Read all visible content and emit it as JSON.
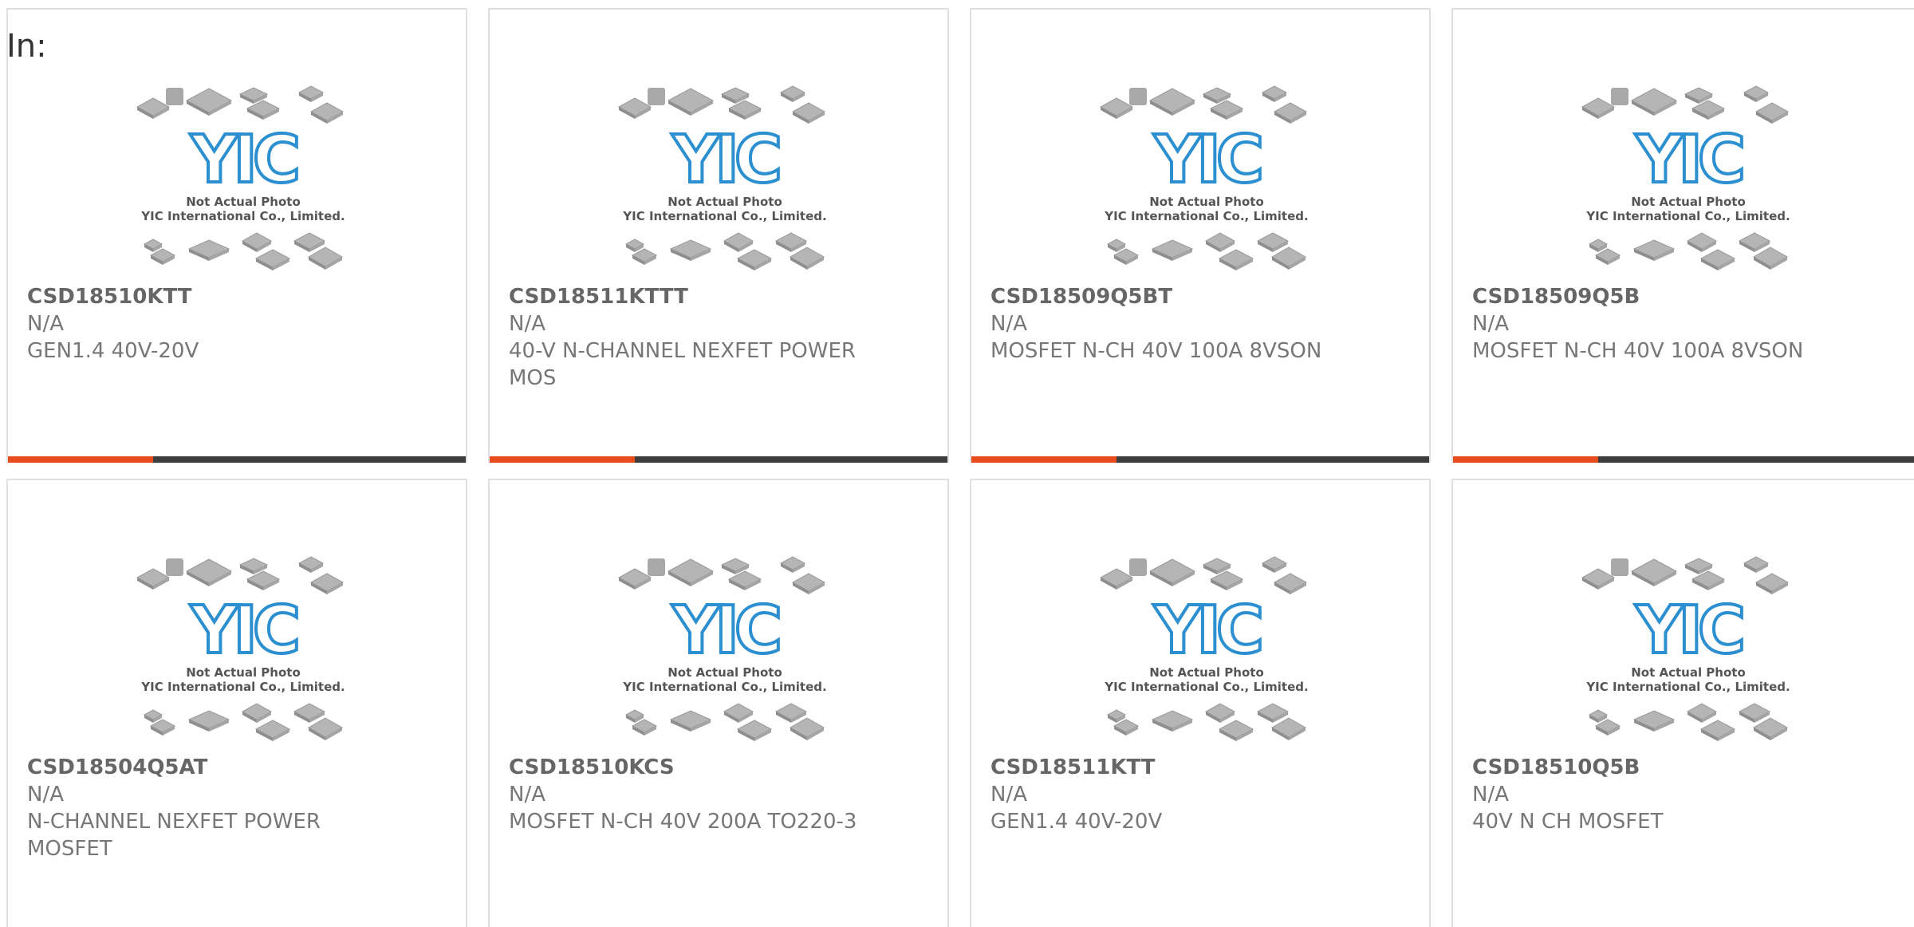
{
  "prefix_label": "In:",
  "photo": {
    "logo_text": "YIC",
    "caption_line1": "Not Actual Photo",
    "caption_line2": "YIC International Co., Limited."
  },
  "colors": {
    "accent": "#e84c1c",
    "bar": "#3d3d3d",
    "logo_blue": "#2b8fd0",
    "chip_gray": "#b5b5b5",
    "text_gray": "#777777"
  },
  "products": [
    {
      "part": "CSD18510KTT",
      "manufacturer": "N/A",
      "description": "GEN1.4 40V-20V"
    },
    {
      "part": "CSD18511KTTT",
      "manufacturer": "N/A",
      "description": "40-V N-CHANNEL NEXFET POWER MOS"
    },
    {
      "part": "CSD18509Q5BT",
      "manufacturer": "N/A",
      "description": "MOSFET N-CH 40V 100A 8VSON"
    },
    {
      "part": "CSD18509Q5B",
      "manufacturer": "N/A",
      "description": "MOSFET N-CH 40V 100A 8VSON"
    },
    {
      "part": "CSD18504Q5AT",
      "manufacturer": "N/A",
      "description": "N-CHANNEL NEXFET POWER MOSFET"
    },
    {
      "part": "CSD18510KCS",
      "manufacturer": "N/A",
      "description": "MOSFET N-CH 40V 200A TO220-3"
    },
    {
      "part": "CSD18511KTT",
      "manufacturer": "N/A",
      "description": "GEN1.4 40V-20V"
    },
    {
      "part": "CSD18510Q5B",
      "manufacturer": "N/A",
      "description": "40V N CH MOSFET"
    }
  ]
}
